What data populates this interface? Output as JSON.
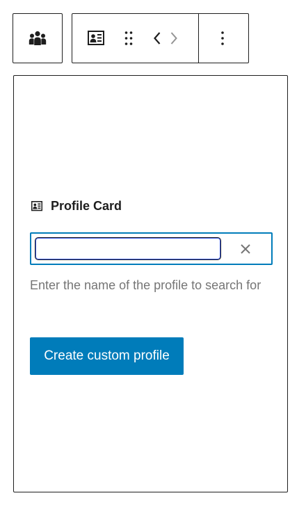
{
  "toolbar": {
    "parent_icon": "people-group-icon",
    "block_icon": "profile-card-icon",
    "drag_icon": "drag-handle-icon",
    "move_left_icon": "chevron-left-icon",
    "move_right_icon": "chevron-right-icon",
    "options_icon": "more-vertical-icon"
  },
  "block": {
    "title": "Profile Card",
    "title_icon": "profile-card-icon",
    "search": {
      "value": "",
      "placeholder": "",
      "clear_icon": "close-icon"
    },
    "help_text": "Enter the name of the profile to search for",
    "create_button_label": "Create custom profile"
  },
  "colors": {
    "accent": "#007cba",
    "focus_ring": "#3858e9",
    "border": "#1e1e1e",
    "help_text": "#757575",
    "disabled_icon": "#949494"
  }
}
